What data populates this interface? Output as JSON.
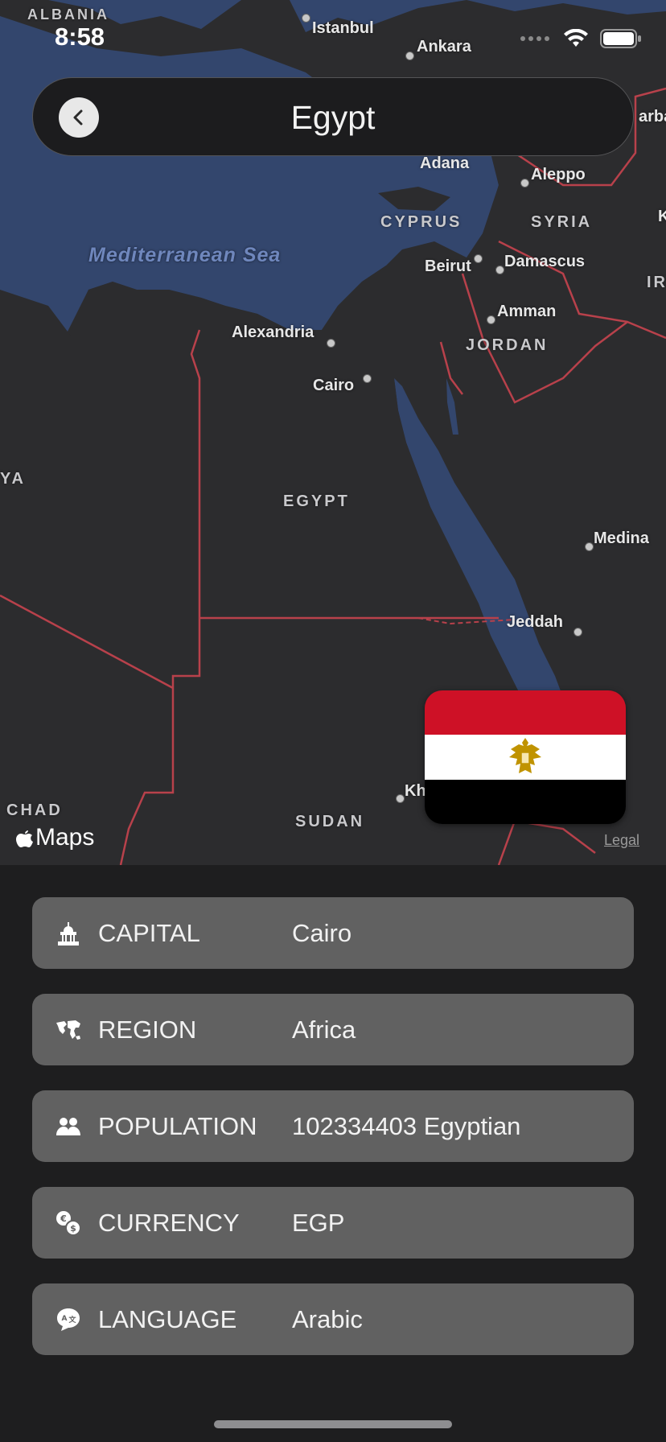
{
  "status_bar": {
    "time": "8:58"
  },
  "header": {
    "title": "Egypt"
  },
  "map": {
    "countries": [
      "ALBANIA",
      "CYPRUS",
      "SYRIA",
      "JORDAN",
      "EGYPT",
      "SUDAN",
      "CHAD",
      "YA",
      "IR"
    ],
    "sea": "Mediterranean Sea",
    "cities": [
      "Istanbul",
      "Ankara",
      "Adana",
      "Aleppo",
      "Beirut",
      "Damascus",
      "Amman",
      "Alexandria",
      "Cairo",
      "Medina",
      "Jeddah",
      "Kh",
      "arba",
      "K"
    ],
    "attribution": "Maps",
    "legal": "Legal"
  },
  "flag": {
    "colors": [
      "#ce1126",
      "#ffffff",
      "#000000"
    ],
    "emblem": "eagle-of-saladin"
  },
  "details": [
    {
      "icon": "capitol-icon",
      "label": "CAPITAL",
      "value": "Cairo"
    },
    {
      "icon": "world-map-icon",
      "label": "REGION",
      "value": "Africa"
    },
    {
      "icon": "people-icon",
      "label": "POPULATION",
      "value": "102334403 Egyptian"
    },
    {
      "icon": "currency-exchange-icon",
      "label": "CURRENCY",
      "value": "EGP"
    },
    {
      "icon": "language-bubble-icon",
      "label": "LANGUAGE",
      "value": "Arabic"
    }
  ],
  "colors": {
    "background": "#1e1e1f",
    "row": "#616161",
    "water": "#33466d",
    "land": "#2c2c2e",
    "border": "#b8414b"
  }
}
